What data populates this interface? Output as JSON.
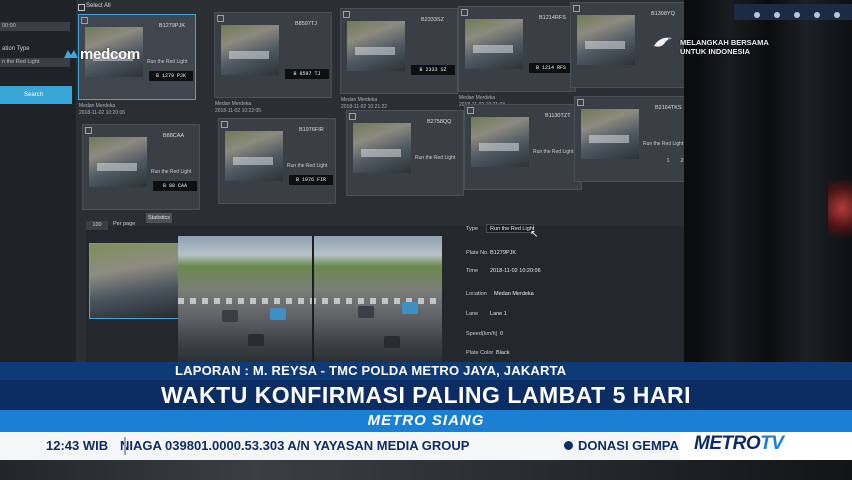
{
  "screen": {
    "left_panel": {
      "label_top": "00:00",
      "type_label": "ation Type",
      "type_value": "n the Red Light",
      "search_button": "Search"
    },
    "select_all": "Select All",
    "cards": [
      {
        "plate": "B1279PJK",
        "type": "Run the Red Light",
        "plate_img": "B 1279 PJK",
        "location": "Medan Merdeka",
        "datetime": "2018-11-02 10:20:06"
      },
      {
        "plate": "B8597TJ",
        "type": "",
        "plate_img": "B 8597 TJ",
        "location": "Medan Merdeka",
        "datetime": "2018-11-02 10:22:05"
      },
      {
        "plate": "B2333SZ",
        "type": "",
        "plate_img": "B 2333 SZ",
        "location": "Medan Merdeka",
        "datetime": "2018-11-02 10:21:22"
      },
      {
        "plate": "B1214RFS",
        "type": "",
        "plate_img": "B 1214 RFS",
        "location": "Medan Merdeka",
        "datetime": "2018-11-02 10:21:03"
      },
      {
        "plate": "B1308YQ",
        "type": "",
        "plate_img": "",
        "location": "",
        "datetime": ""
      },
      {
        "plate": "B88CAA",
        "type": "Run the Red Light",
        "plate_img": "B 88 CAA",
        "location": "",
        "datetime": ""
      },
      {
        "plate": "B1976FIR",
        "type": "Run the Red Light",
        "plate_img": "B 1976 FIR",
        "location": "",
        "datetime": ""
      },
      {
        "plate": "B2758QQ",
        "type": "Run the Red Light",
        "plate_img": "",
        "location": "",
        "datetime": ""
      },
      {
        "plate": "B1130TZT",
        "type": "Run the Red Light",
        "plate_img": "",
        "location": "",
        "datetime": ""
      },
      {
        "plate": "B2164TKS",
        "type": "Run the Red Light",
        "plate_img": "",
        "location": "",
        "datetime": ""
      }
    ],
    "per_page_value": "100",
    "per_page_label": "Per page",
    "statistics_button": "Statistics",
    "pager": [
      "1",
      "2"
    ],
    "detail": {
      "type_label": "Type",
      "type_value": "Run the Red Light",
      "plate_label": "Plate No.",
      "plate_value": "B1279PJK",
      "time_label": "Time",
      "time_value": "2018-11-02 10:20:06",
      "location_label": "Location",
      "location_value": "Medan Merdeka",
      "lane_label": "Lane",
      "lane_value": "Lane 1",
      "speed_label": "Speed(km/h)",
      "speed_value": "0",
      "color_label": "Plate Color",
      "color_value": "Black"
    }
  },
  "overlay": {
    "medcom_logo": "medcom",
    "slogan_line1": "MELANGKAH BERSAMA",
    "slogan_line2": "UNTUK INDONESIA"
  },
  "lower_third": {
    "reporter": "LAPORAN : M. REYSA - TMC POLDA METRO JAYA, JAKARTA",
    "headline": "WAKTU KONFIRMASI PALING LAMBAT 5 HARI",
    "program": "METRO SIANG",
    "clock": "12:43 WIB",
    "ticker": "NIAGA 039801.0000.53.303 A/N YAYASAN MEDIA GROUP",
    "ticker2": "DONASI GEMPA",
    "channel_logo_a": "METRO",
    "channel_logo_b": "TV"
  },
  "colors": {
    "accent_blue": "#1b7fd3",
    "navy": "#0b2d63",
    "ui_highlight": "#3fa7d9"
  }
}
